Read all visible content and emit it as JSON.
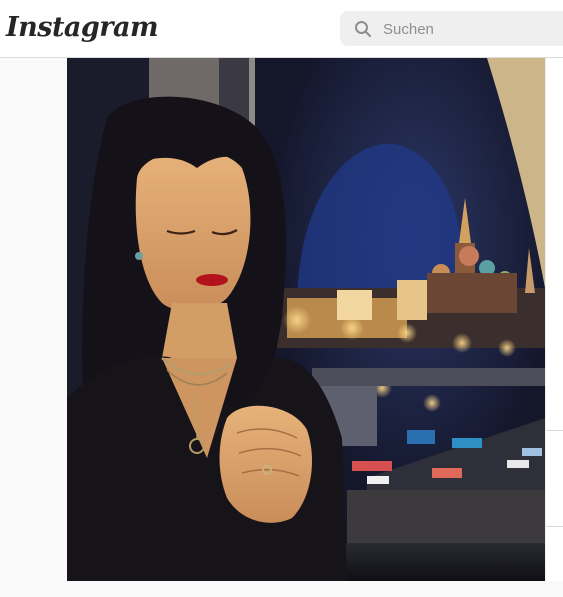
{
  "header": {
    "logo_text": "Instagram",
    "search": {
      "placeholder": "Suchen",
      "icon": "search-icon"
    }
  },
  "post": {
    "image_icon": "photo",
    "colors": {
      "night_sky": "#1e2138",
      "lights": "#f3d59a",
      "dress": "#161418",
      "lipstick": "#b1121b"
    }
  }
}
